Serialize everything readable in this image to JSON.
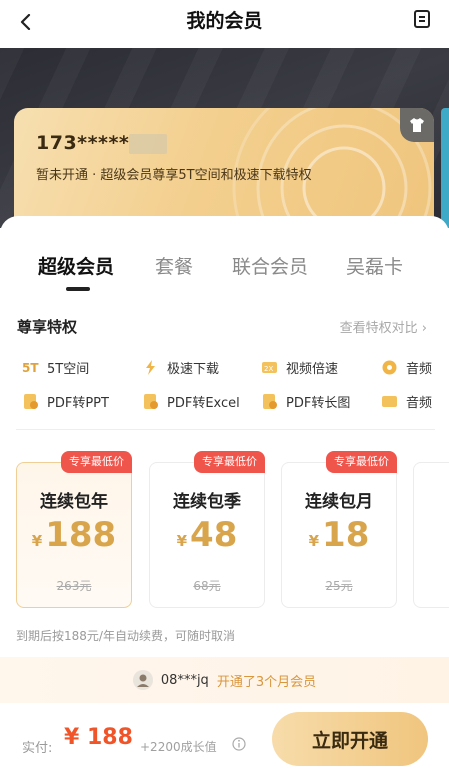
{
  "header": {
    "title": "我的会员"
  },
  "card": {
    "phone": "173*****",
    "description": "暂未开通 · 超级会员尊享5T空间和极速下载特权"
  },
  "tabs": [
    {
      "label": "超级会员"
    },
    {
      "label": "套餐"
    },
    {
      "label": "联合会员"
    },
    {
      "label": "吴磊卡"
    }
  ],
  "privileges": {
    "title": "尊享特权",
    "link": "查看特权对比 ›",
    "items": [
      {
        "label": "5T空间",
        "icon": "5t-icon"
      },
      {
        "label": "极速下载",
        "icon": "lightning-icon"
      },
      {
        "label": "视频倍速",
        "icon": "video-speed-icon"
      },
      {
        "label": "音频",
        "icon": "audio-icon"
      },
      {
        "label": "PDF转PPT",
        "icon": "pdf-ppt-icon"
      },
      {
        "label": "PDF转Excel",
        "icon": "pdf-excel-icon"
      },
      {
        "label": "PDF转长图",
        "icon": "pdf-image-icon"
      },
      {
        "label": "音频",
        "icon": "audio-text-icon"
      }
    ]
  },
  "plans": [
    {
      "tag": "专享最低价",
      "name": "连续包年",
      "currency": "¥",
      "price": "188",
      "original": "263元"
    },
    {
      "tag": "专享最低价",
      "name": "连续包季",
      "currency": "¥",
      "price": "48",
      "original": "68元"
    },
    {
      "tag": "专享最低价",
      "name": "连续包月",
      "currency": "¥",
      "price": "18",
      "original": "25元"
    }
  ],
  "renew_note": "到期后按188元/年自动续费，可随时取消",
  "ticker": {
    "user": "08***jq",
    "action": "开通了3个月会员"
  },
  "bottom": {
    "pay_label": "实付:",
    "pay_amount": "¥ 188",
    "growth": "+2200成长值",
    "open_button": "立即开通"
  },
  "colors": {
    "accent_gold": "#d9a54c",
    "tag_red": "#f0554c",
    "price_orange": "#f0552a"
  }
}
